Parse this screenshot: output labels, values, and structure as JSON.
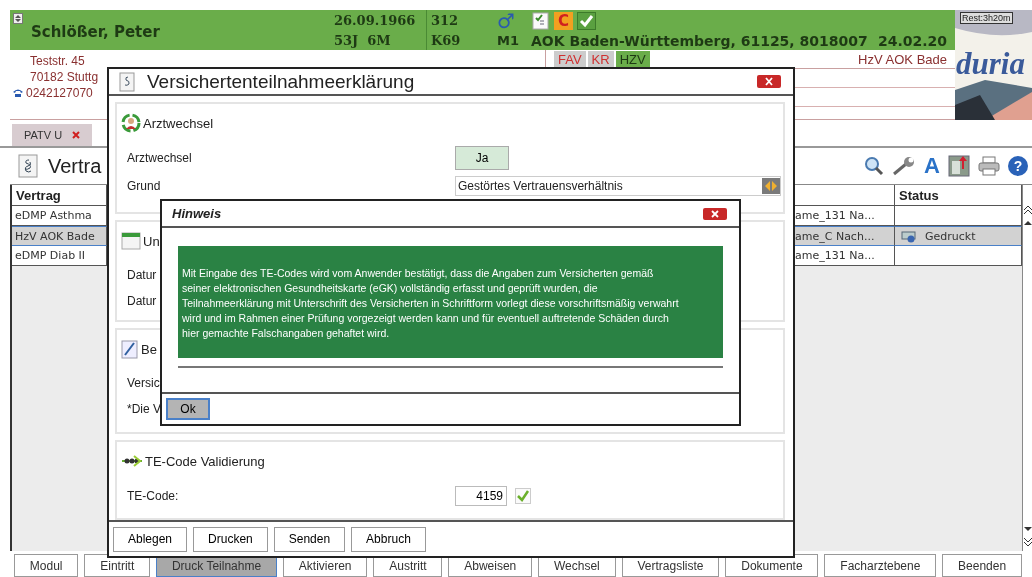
{
  "patient": {
    "name": "Schlößer, Peter",
    "birth_date": "26.09.1966",
    "age": "53J  6M",
    "code_1": "312",
    "code_2": "K69",
    "gender": "♂",
    "group": "M1",
    "badge": "C",
    "insurance": "AOK Baden-Württemberg, 61125, 8018007",
    "date": "24.02.20",
    "street": "Teststr. 45",
    "city": "70182 Stuttg",
    "phone": "0242127070",
    "contract_note": "HzV AOK Bade"
  },
  "programs": [
    {
      "label": "FAV",
      "active": false
    },
    {
      "label": "KR",
      "active": false
    },
    {
      "label": "HZV",
      "active": true
    }
  ],
  "logo": {
    "timer": "Rest:3h20m",
    "brand": "duria"
  },
  "tabs": [
    {
      "label": "PATV U",
      "selected": true
    }
  ],
  "page_title": "Vertra",
  "toolbar": {
    "font_glyph": "A",
    "help_glyph": "?"
  },
  "table": {
    "columns": [
      "Vertrag",
      "Status"
    ],
    "rows": [
      {
        "vertrag": "eDMP Asthma",
        "column_3": "ame_131 Na...",
        "selected": false
      },
      {
        "vertrag": "HzV AOK Bade",
        "column_3": "ame_C Nach...",
        "status": "Gedruckt",
        "selected": true
      },
      {
        "vertrag": "eDMP Diab II",
        "column_3": "ame_131 Na...",
        "selected": false
      }
    ]
  },
  "dialog": {
    "title": "Versichertenteilnahmeerklärung",
    "sections": [
      {
        "kind": "doctor_change",
        "title": "Arztwechsel",
        "change_label": "Arztwechsel",
        "change_value": "Ja",
        "reason_label": "Grund",
        "reason_value": "Gestörtes Vertrauensverhältnis"
      },
      {
        "kind": "dates",
        "title": "Un",
        "lines": [
          "Datur",
          "Datur"
        ]
      },
      {
        "kind": "notes",
        "title": "Be",
        "lines": [
          "Versic",
          "*Die V"
        ]
      },
      {
        "kind": "te_code",
        "title": "TE-Code Validierung",
        "label": "TE-Code:",
        "value": "4159",
        "valid": true
      }
    ],
    "buttons": [
      "Ablegen",
      "Drucken",
      "Senden",
      "Abbruch"
    ]
  },
  "hint": {
    "title": "Hinweis",
    "message": "Mit Eingabe des TE-Codes wird vom Anwender bestätigt, dass die Angaben zum Versicherten gemäß seiner elektronischen Gesundheitskarte (eGK) vollständig erfasst und geprüft wurden, die Teilnahmeerklärung mit Unterschrift des Versicherten in Schriftform vorlegt diese vorschriftsmäßig verwahrt wird und im Rahmen einer Prüfung vorgezeigt werden kann und für eventuell auftretende Schäden durch hier gemachte Falschangaben gehaftet wird.",
    "button": "Ok"
  },
  "buttons": [
    {
      "label": "Modul",
      "pressed": false
    },
    {
      "label": "Eintritt",
      "pressed": false
    },
    {
      "label": "Druck Teilnahme",
      "pressed": true
    },
    {
      "label": "Aktivieren",
      "pressed": false
    },
    {
      "label": "Austritt",
      "pressed": false
    },
    {
      "label": "Abweisen",
      "pressed": false
    },
    {
      "label": "Wechsel",
      "pressed": false
    },
    {
      "label": "Vertragsliste",
      "pressed": false
    },
    {
      "label": "Dokumente",
      "pressed": false
    },
    {
      "label": "Facharztebene",
      "pressed": false
    },
    {
      "label": "Beenden",
      "pressed": false
    }
  ]
}
